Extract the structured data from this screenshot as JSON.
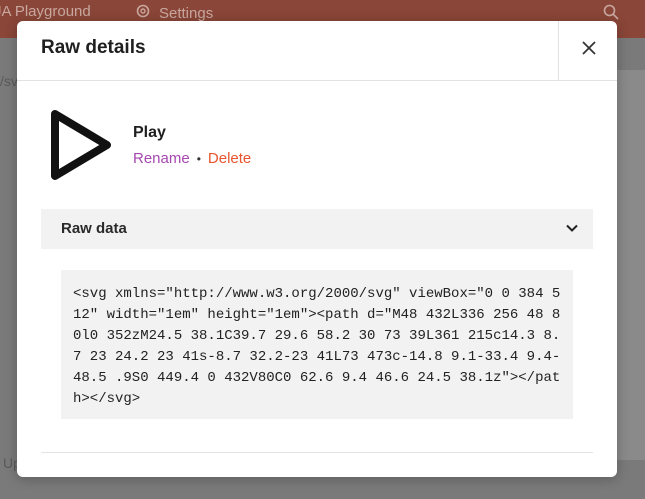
{
  "background": {
    "app_title": "JA Playground",
    "settings_label": "Settings",
    "left_text_top": "/sv",
    "left_text_bottom": "Up"
  },
  "modal": {
    "title": "Raw details",
    "asset": {
      "name": "Play",
      "rename_label": "Rename",
      "separator": "•",
      "delete_label": "Delete"
    },
    "accordion": {
      "label": "Raw data",
      "expanded": true
    },
    "raw_data": "<svg xmlns=\"http://www.w3.org/2000/svg\" viewBox=\"0 0 384 512\" width=\"1em\" height=\"1em\"><path d=\"M48 432L336 256 48 80l0 352zM24.5 38.1C39.7 29.6 58.2 30 73 39L361 215c14.3 8.7 23 24.2 23 41s-8.7 32.2-23 41L73 473c-14.8 9.1-33.4 9.4-48.5 .9S0 449.4 0 432V80C0 62.6 9.4 46.6 24.5 38.1z\"></path></svg>"
  },
  "colors": {
    "rename": "#a648b0",
    "delete": "#e8552e",
    "header_bg": "#8a4638",
    "accordion_bg": "#f2f2f2"
  },
  "icons": {
    "asset": "play-outline-icon",
    "close": "close-icon",
    "chevron": "chevron-down-icon",
    "settings": "gear-icon",
    "search": "search-icon"
  }
}
